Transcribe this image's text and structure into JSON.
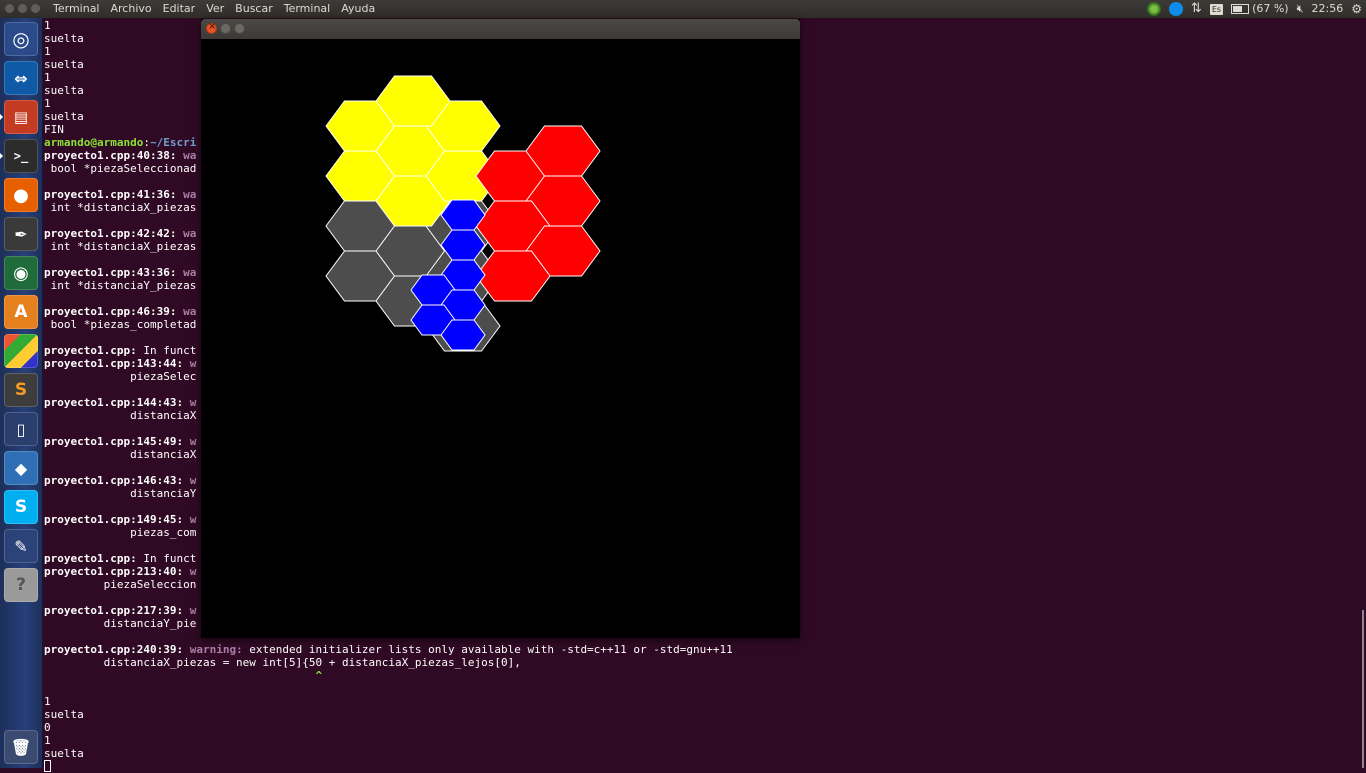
{
  "topbar": {
    "menu": [
      "Terminal",
      "Archivo",
      "Editar",
      "Ver",
      "Buscar",
      "Terminal",
      "Ayuda"
    ],
    "keyboard_layout": "Es",
    "battery": "(67 %)",
    "clock": "22:56"
  },
  "launcher": {
    "items": [
      "dash-icon",
      "teamviewer-icon",
      "files-icon",
      "terminal-icon",
      "firefox-icon",
      "inkscape-icon",
      "webcam-icon",
      "software-center-icon",
      "workspaces-icon",
      "sublime-icon",
      "phone-icon",
      "virtualbox-icon",
      "skype-icon",
      "pen-icon",
      "help-icon",
      "trash-icon"
    ]
  },
  "terminal": {
    "lines": [
      "1",
      "suelta",
      "1",
      "suelta",
      "1",
      "suelta",
      "1",
      "suelta",
      "FIN",
      {
        "prompt_user": "armando@armando",
        "prompt_sep": ":",
        "prompt_path": "~/Escri"
      },
      {
        "loc": "proyecto1.cpp:40:38:",
        "kind": "wa"
      },
      " bool *piezaSeleccionad",
      "",
      {
        "loc": "proyecto1.cpp:41:36:",
        "kind": "wa"
      },
      " int *distanciaX_piezas",
      "",
      {
        "loc": "proyecto1.cpp:42:42:",
        "kind": "wa"
      },
      " int *distanciaX_piezas",
      "",
      {
        "loc": "proyecto1.cpp:43:36:",
        "kind": "wa"
      },
      " int *distanciaY_piezas",
      "",
      {
        "loc": "proyecto1.cpp:46:39:",
        "kind": "wa"
      },
      " bool *piezas_completad",
      "",
      {
        "loc": "proyecto1.cpp:",
        "rest": " In funct"
      },
      {
        "loc": "proyecto1.cpp:143:44:",
        "kind": "w"
      },
      "             piezaSelec",
      "",
      {
        "loc": "proyecto1.cpp:144:43:",
        "kind": "w"
      },
      "             distanciaX",
      "",
      {
        "loc": "proyecto1.cpp:145:49:",
        "kind": "w"
      },
      "             distanciaX",
      "",
      {
        "loc": "proyecto1.cpp:146:43:",
        "kind": "w"
      },
      "             distanciaY",
      "",
      {
        "loc": "proyecto1.cpp:149:45:",
        "kind": "w"
      },
      "             piezas_com",
      "",
      {
        "loc": "proyecto1.cpp:",
        "rest": " In funct"
      },
      {
        "loc": "proyecto1.cpp:213:40:",
        "kind": "w"
      },
      "         piezaSeleccion",
      "",
      {
        "loc": "proyecto1.cpp:217:39:",
        "kind": "w"
      },
      "         distanciaY_pie",
      "",
      {
        "loc": "proyecto1.cpp:240:39:",
        "kind": "warning:",
        "rest": " extended initializer lists only available with -std=c++11 or -std=gnu++11"
      },
      "         distanciaX_piezas = new int[5]{50 + distanciaX_piezas_lejos[0],",
      {
        "caret_pad": "                                         ",
        "caret": "^"
      },
      "",
      "1",
      "suelta",
      "0",
      "1",
      "suelta"
    ]
  },
  "board": {
    "colors": {
      "yellow": "#ffff00",
      "red": "#ff0000",
      "gray": "#4d4d4d",
      "blue": "#0000ff",
      "outline": "#ffffff"
    },
    "pieces": [
      {
        "color": "gray",
        "cells": [
          [
            1,
            5
          ],
          [
            1,
            7
          ],
          [
            2,
            6
          ],
          [
            3,
            5
          ],
          [
            3,
            7
          ]
        ]
      },
      {
        "color": "yellow",
        "cells": [
          [
            1,
            1
          ],
          [
            1,
            3
          ],
          [
            2,
            2
          ],
          [
            2,
            4
          ],
          [
            3,
            1
          ],
          [
            3,
            3
          ],
          [
            2,
            0
          ]
        ]
      },
      {
        "color": "red",
        "cells": [
          [
            4,
            3
          ],
          [
            5,
            2
          ],
          [
            5,
            4
          ],
          [
            4,
            5
          ],
          [
            5,
            6
          ],
          [
            4,
            7
          ]
        ]
      },
      {
        "color": "gray",
        "cells": [
          [
            2,
            8
          ],
          [
            3,
            9
          ]
        ]
      }
    ],
    "small_blue": [
      [
        0,
        0
      ],
      [
        0,
        1
      ],
      [
        0,
        2
      ],
      [
        -1,
        3
      ],
      [
        0,
        3
      ],
      [
        -1,
        4
      ],
      [
        0,
        4
      ]
    ]
  }
}
